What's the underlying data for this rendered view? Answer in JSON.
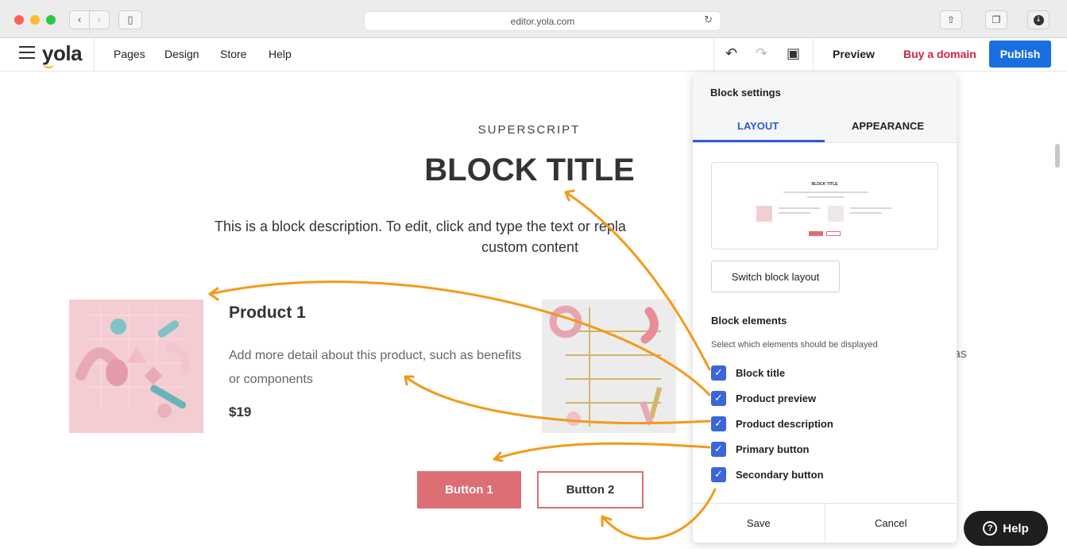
{
  "browser": {
    "url": "editor.yola.com",
    "back_glyph": "‹",
    "forward_glyph": "›",
    "sidebar_glyph": "▯",
    "reload_glyph": "↻",
    "share_glyph": "⇧",
    "tabs_glyph": "❐",
    "download_glyph": "↓"
  },
  "topbar": {
    "logo": "yola",
    "menu": [
      "Pages",
      "Design",
      "Store",
      "Help"
    ],
    "undo_glyph": "↶",
    "redo_glyph": "↷",
    "save_glyph": "▣",
    "preview": "Preview",
    "buy_domain": "Buy a domain",
    "publish": "Publish"
  },
  "block": {
    "superscript": "SUPERSCRIPT",
    "title": "BLOCK TITLE",
    "description_line1": "This is a block description. To edit, click and type the text or repla",
    "description_line2": "custom content",
    "product1": {
      "title": "Product 1",
      "description": "Add more detail about this product, such as benefits or components",
      "price": "$19"
    },
    "product2_desc_tail": "as",
    "button1": "Button 1",
    "button2": "Button 2"
  },
  "panel": {
    "title": "Block settings",
    "tabs": [
      "LAYOUT",
      "APPEARANCE"
    ],
    "active_tab": "LAYOUT",
    "thumbnail_title": "BLOCK TITLE",
    "switch_layout": "Switch block layout",
    "elements_title": "Block elements",
    "elements_help": "Select which elements should be displayed",
    "elements": [
      {
        "label": "Block title",
        "checked": true
      },
      {
        "label": "Product preview",
        "checked": true
      },
      {
        "label": "Product description",
        "checked": true
      },
      {
        "label": "Primary button",
        "checked": true
      },
      {
        "label": "Secondary button",
        "checked": true
      }
    ],
    "check_glyph": "✓",
    "save": "Save",
    "cancel": "Cancel"
  },
  "help_widget": {
    "glyph": "?",
    "label": "Help"
  },
  "colors": {
    "accent_blue": "#2d5bd8",
    "publish_blue": "#1a6fe0",
    "buy_red": "#d4224a",
    "button_pink": "#dd6e76",
    "annotation_orange": "#f39a1b"
  }
}
